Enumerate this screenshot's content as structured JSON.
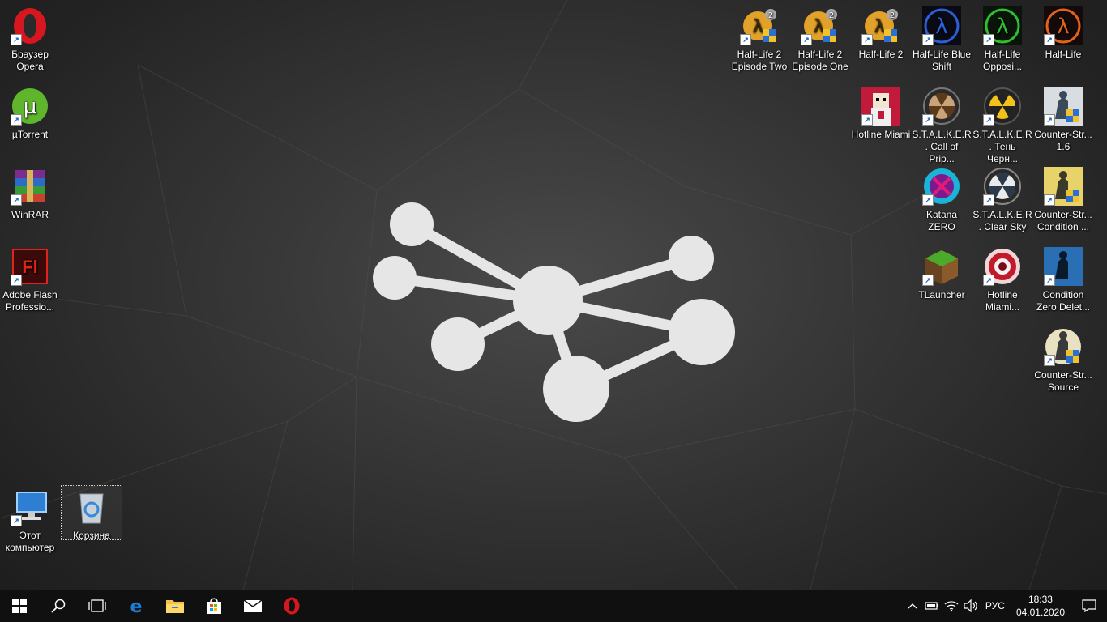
{
  "desktop": {
    "left_icons": [
      {
        "name": "opera-icon",
        "label": "Браузер Opera"
      },
      {
        "name": "utorrent-icon",
        "label": "µTorrent"
      },
      {
        "name": "winrar-icon",
        "label": "WinRAR"
      },
      {
        "name": "adobe-flash-icon",
        "label": "Adobe Flash Professio..."
      },
      {
        "name": "this-pc-icon",
        "label": "Этот компьютер"
      },
      {
        "name": "recycle-bin-icon",
        "label": "Корзина"
      }
    ],
    "right_icons": [
      {
        "name": "half-life-2-ep2-icon",
        "label": "Half-Life 2 Episode Two"
      },
      {
        "name": "half-life-2-ep1-icon",
        "label": "Half-Life 2 Episode One"
      },
      {
        "name": "half-life-2-icon",
        "label": "Half-Life 2"
      },
      {
        "name": "half-life-blue-shift-icon",
        "label": "Half-Life Blue Shift"
      },
      {
        "name": "half-life-opposing-icon",
        "label": "Half-Life Opposi..."
      },
      {
        "name": "half-life-icon",
        "label": "Half-Life"
      },
      {
        "name": "hotline-miami-icon",
        "label": "Hotline Miami"
      },
      {
        "name": "stalker-cop-icon",
        "label": "S.T.A.L.K.E.R. Call of Prip..."
      },
      {
        "name": "stalker-shoc-icon",
        "label": "S.T.A.L.K.E.R. Тень Черн..."
      },
      {
        "name": "counter-strike-16-icon",
        "label": "Counter-Str... 1.6"
      },
      {
        "name": "katana-zero-icon",
        "label": "Katana ZERO"
      },
      {
        "name": "stalker-cs-icon",
        "label": "S.T.A.L.K.E.R. Clear Sky"
      },
      {
        "name": "counter-strike-cz-icon",
        "label": "Counter-Str... Condition ..."
      },
      {
        "name": "tlauncher-icon",
        "label": "TLauncher"
      },
      {
        "name": "hotline-miami-2-icon",
        "label": "Hotline Miami..."
      },
      {
        "name": "condition-zero-deleted-icon",
        "label": "Condition Zero Delet..."
      },
      {
        "name": "counter-strike-source-icon",
        "label": "Counter-Str... Source"
      }
    ]
  },
  "taskbar": {
    "apps": [
      "windows-start-icon",
      "search-icon",
      "task-view-icon",
      "edge-icon",
      "file-explorer-icon",
      "store-icon",
      "mail-icon",
      "opera-icon"
    ],
    "tray": {
      "language": "РУС",
      "time": "18:33",
      "date": "04.01.2020"
    }
  },
  "colors": {
    "taskbar": "#101010",
    "wallpaper_logo": "#e6e6e6",
    "opera_red": "#d7171f",
    "utorrent_green": "#5fb52c",
    "edge_blue": "#1b7fd4"
  }
}
